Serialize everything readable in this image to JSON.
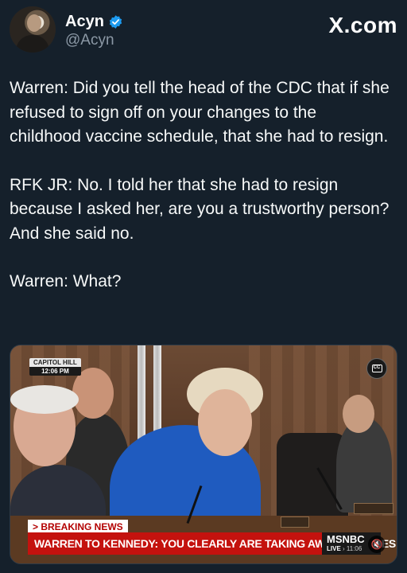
{
  "author": {
    "name": "Acyn",
    "handle": "@Acyn",
    "verified_icon": "verified-badge-icon",
    "avatar_icon": "avatar-photo"
  },
  "brand": "X.com",
  "tweet": {
    "paragraphs": [
      "Warren: Did you tell the head of the CDC that if she refused to sign off on your changes to the childhood vaccine schedule, that she had to resign.",
      "RFK JR: No. I told her that she had to resign because I asked her, are you a trustworthy person? And she said no.",
      "Warren: What?"
    ]
  },
  "media": {
    "location_top": "CAPITOL HILL",
    "location_time": "12:06 PM",
    "cc_icon": "closed-captions-icon",
    "breaking_label": "> BREAKING NEWS",
    "chyron": "WARREN TO KENNEDY: YOU CLEARLY ARE TAKING AWAY VACCINES",
    "network_logo": "MSNBC",
    "live_label": "LIVE",
    "live_time": "11:06",
    "mute_icon": "speaker-muted-icon"
  },
  "colors": {
    "background": "#15202b",
    "verified": "#1d9bf0",
    "chyron_red": "#c4120e",
    "secondary_text": "#8b98a5"
  }
}
